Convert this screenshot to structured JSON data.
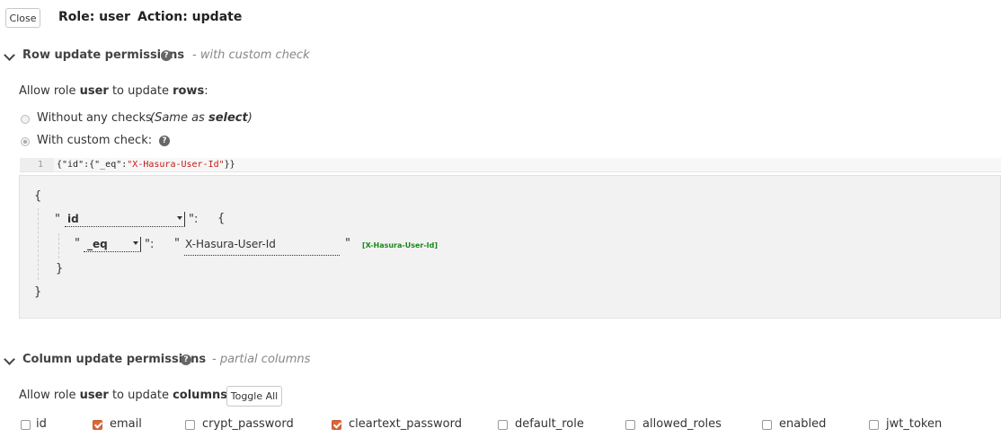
{
  "header": {
    "close_label": "Close",
    "role_text": "Role: user",
    "action_text": "Action: update"
  },
  "row_section": {
    "title": "Row update permissions",
    "status": "- with custom check",
    "allow_prefix": "Allow role ",
    "allow_role": "user",
    "allow_mid": " to update ",
    "allow_object": "rows",
    "allow_suffix": ":",
    "options": [
      {
        "label": "Without any checks",
        "note_prefix": "(Same as ",
        "note_bold": "select",
        "note_suffix": ")",
        "selected": false
      },
      {
        "label": "With custom check:",
        "selected": true
      }
    ],
    "editor": {
      "line_number": "1",
      "code_prefix": "{\"id\":{\"_eq\":",
      "code_string": "\"X-Hasura-User-Id\"",
      "code_suffix": "}}"
    },
    "builder": {
      "open_brace": "{",
      "close_brace": "}",
      "inner_close": "}",
      "quote": "\"",
      "quote_colon": "\":",
      "inner_open": "{",
      "column_select": "id",
      "operator_select": "_eq",
      "value": "X-Hasura-User-Id",
      "session_var": "[X-Hasura-User-Id]"
    }
  },
  "column_section": {
    "title": "Column update permissions",
    "status": "- partial columns",
    "allow_prefix": "Allow role ",
    "allow_role": "user",
    "allow_mid": " to update ",
    "allow_object": "columns",
    "allow_suffix": ":",
    "toggle_all_label": "Toggle All",
    "columns": [
      {
        "name": "id",
        "checked": false
      },
      {
        "name": "email",
        "checked": true
      },
      {
        "name": "crypt_password",
        "checked": false
      },
      {
        "name": "cleartext_password",
        "checked": true
      },
      {
        "name": "default_role",
        "checked": false
      },
      {
        "name": "allowed_roles",
        "checked": false
      },
      {
        "name": "enabled",
        "checked": false
      },
      {
        "name": "jwt_token",
        "checked": false
      }
    ]
  },
  "colors": {
    "accent_checkbox": "#d9673a",
    "session_var": "#1a8a1a",
    "code_string": "#c41a16"
  },
  "icons": [
    "chevron-down-icon",
    "help-circle-icon"
  ]
}
